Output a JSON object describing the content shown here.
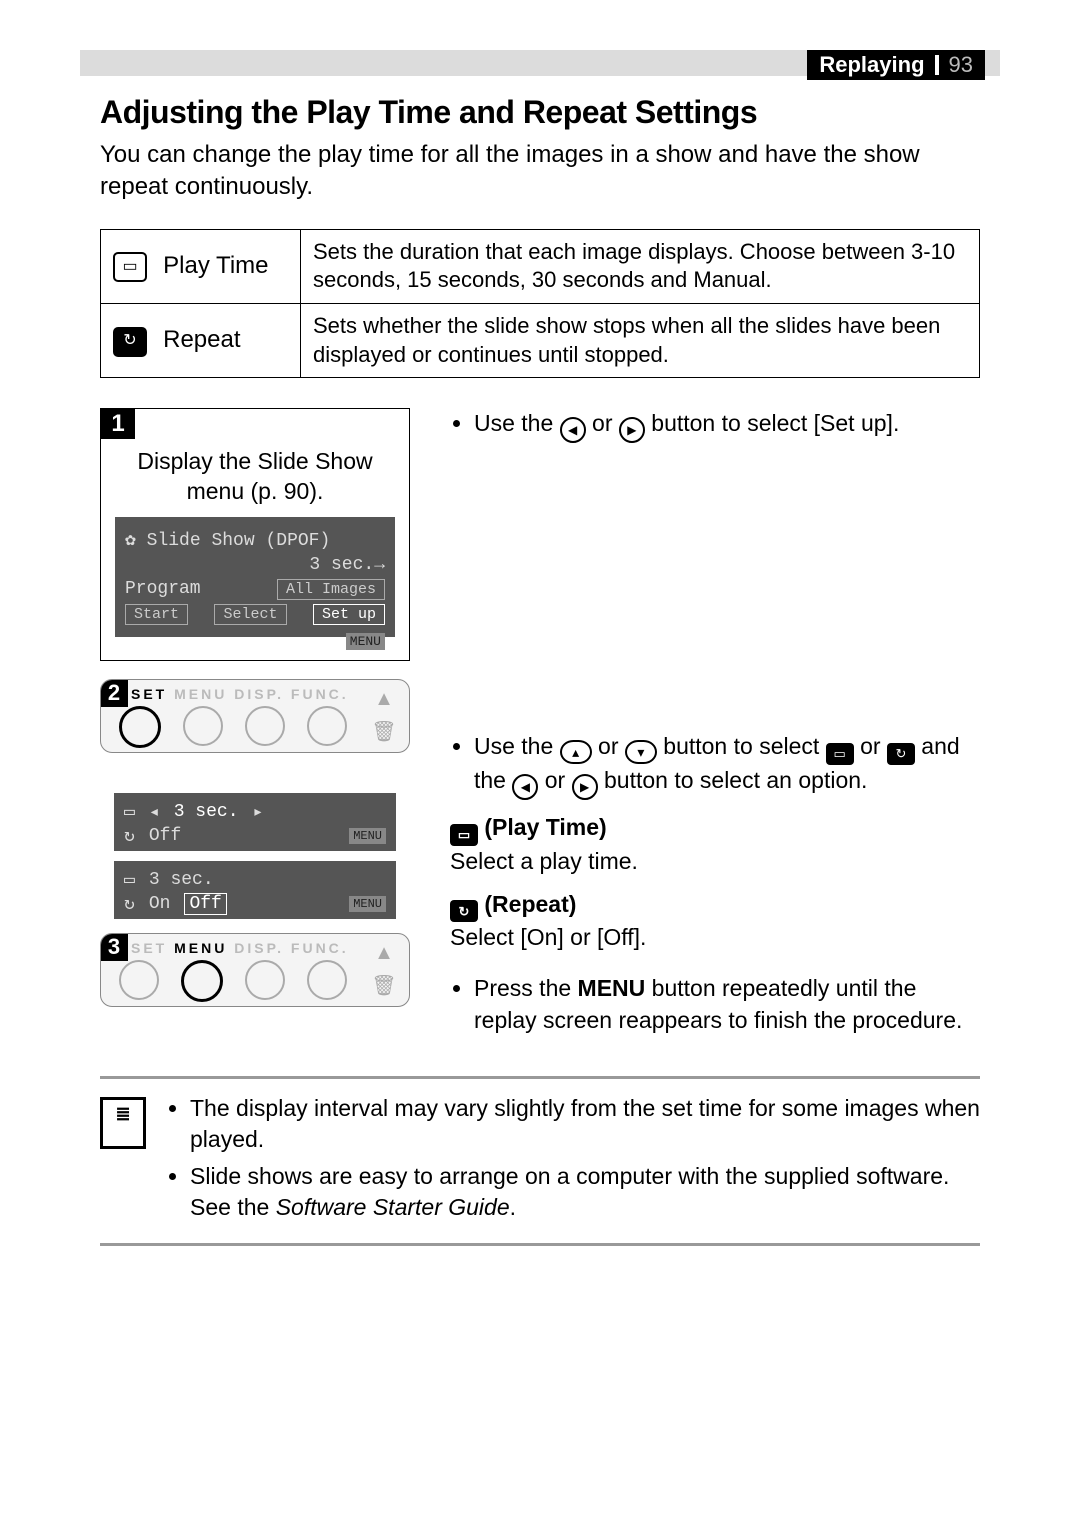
{
  "header": {
    "section": "Replaying",
    "page": "93"
  },
  "title": "Adjusting the Play Time and Repeat Settings",
  "intro": "You can change the play time for all the images in a show and have the show repeat continuously.",
  "table": {
    "row1": {
      "label": "Play Time",
      "desc": "Sets the duration that each image displays. Choose between 3-10 seconds, 15 seconds, 30 seconds and Manual."
    },
    "row2": {
      "label": "Repeat",
      "desc": "Sets whether the slide show stops when all the slides have been displayed or continues until stopped."
    }
  },
  "step1": {
    "num": "1",
    "caption": "Display the Slide Show menu (p. 90).",
    "lcd": {
      "title": "Slide Show (DPOF)",
      "time": "3 sec.",
      "program": "Program",
      "allimages": "All Images",
      "start": "Start",
      "select": "Select",
      "setup": "Set up",
      "menu": "MENU"
    }
  },
  "right1": {
    "text_a": "Use the ",
    "text_b": " or ",
    "text_c": " button to select [Set up]."
  },
  "step2": {
    "num": "2",
    "labels": {
      "set": "SET",
      "menu": "MENU",
      "disp": "DISP.",
      "func": "FUNC."
    }
  },
  "right2": {
    "line1_a": "Use the ",
    "line1_b": " or ",
    "line1_c": " button to select ",
    "line1_d": " or ",
    "line1_e": " and the ",
    "line1_f": " or ",
    "line1_g": " button to select an option.",
    "pt_head": "(Play Time)",
    "pt_body": "Select a play time.",
    "rp_head": "(Repeat)",
    "rp_body": "Select [On] or [Off]."
  },
  "mini1": {
    "time": "3 sec.",
    "off": "Off",
    "menu": "MENU"
  },
  "mini2": {
    "time": "3 sec.",
    "on": "On",
    "off": "Off",
    "menu": "MENU"
  },
  "step3": {
    "num": "3",
    "labels": {
      "set": "SET",
      "menu": "MENU",
      "disp": "DISP.",
      "func": "FUNC."
    },
    "text_a": "Press the ",
    "text_b": "MENU",
    "text_c": " button repeatedly until the replay screen reappears to finish the procedure."
  },
  "note": {
    "n1": "The display interval may vary slightly from the set time for some images when played.",
    "n2_a": "Slide shows are easy to arrange on a computer with the supplied software. See the ",
    "n2_b": "Software Starter Guide",
    "n2_c": "."
  }
}
